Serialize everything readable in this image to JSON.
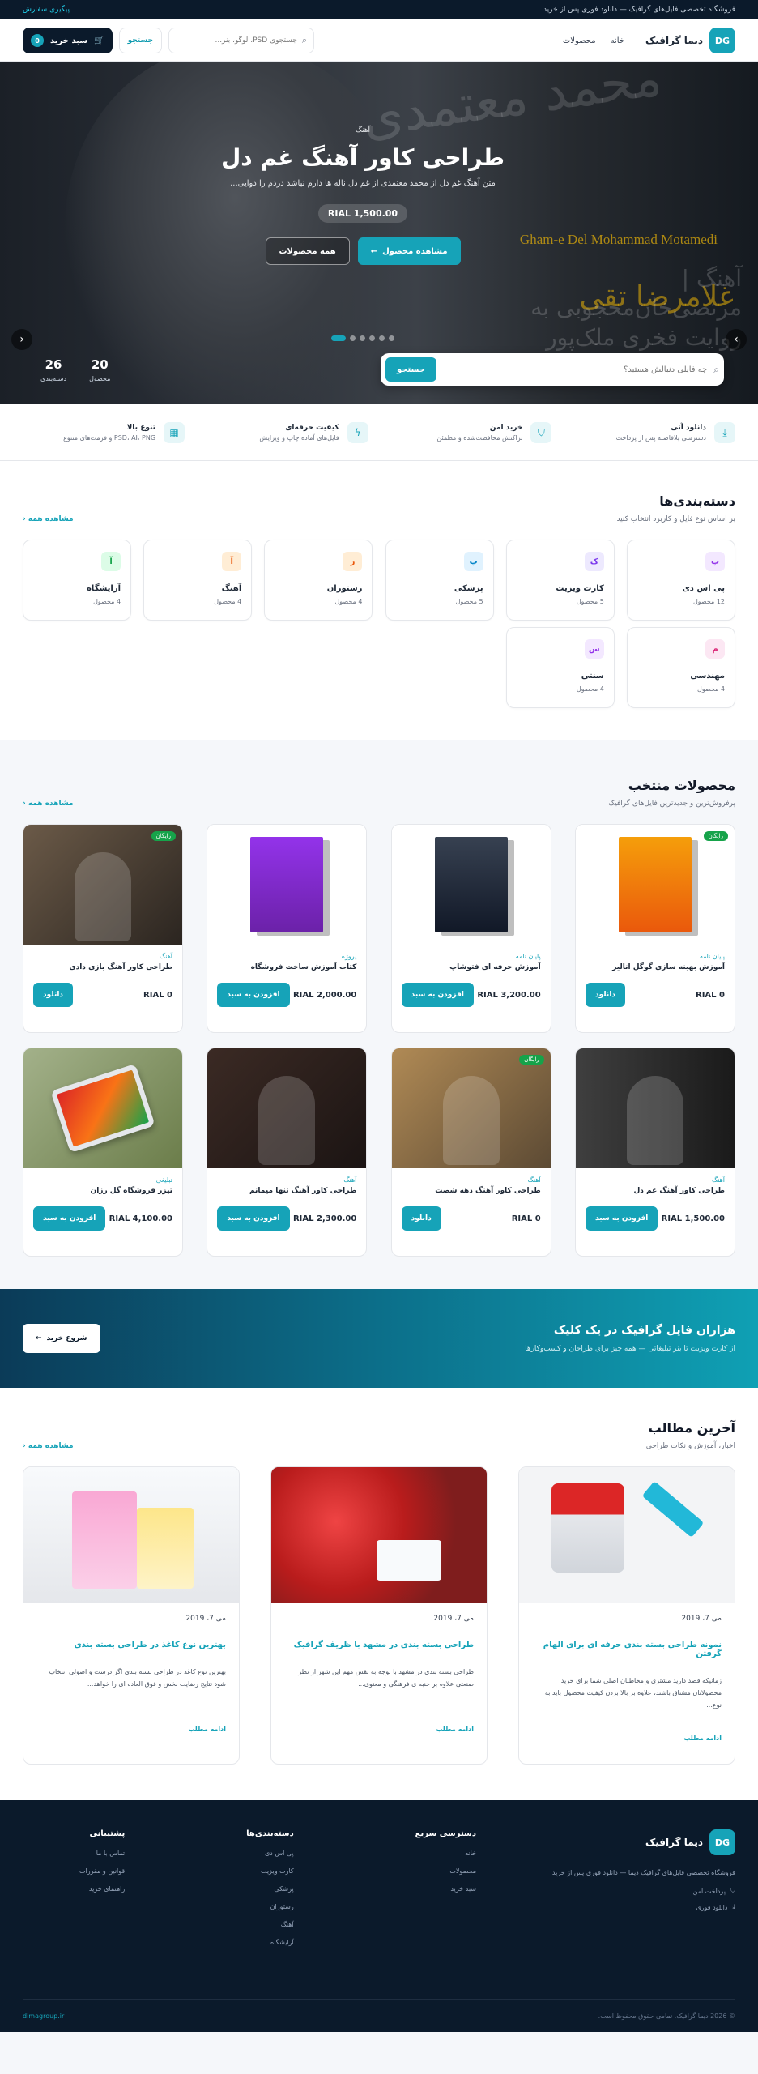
{
  "topbar": {
    "tagline": "فروشگاه تخصصی فایل‌های گرافیک — دانلود فوری پس از خرید",
    "track": "پیگیری سفارش"
  },
  "header": {
    "logo": "DG",
    "brand": "دیما گرافیک",
    "nav": [
      "خانه",
      "محصولات"
    ],
    "search_placeholder": "جستجوی PSD، لوگو، بنر...",
    "search_btn": "جستجو",
    "cart_label": "سبد خرید",
    "cart_count": "0"
  },
  "hero": {
    "category": "آهنگ",
    "title": "طراحی کاور آهنگ غم دل",
    "desc": "متن آهنگ غم دل از محمد معتمدی از غم دل ناله ها دارم نباشد دردم را دوایی...",
    "price": "RIAL 1,500.00",
    "btn_view": "مشاهده محصول",
    "btn_all": "همه محصولات",
    "search_placeholder": "چه فایلی دنبالش هستید؟",
    "search_btn": "جستجو",
    "stats": [
      {
        "num": "20",
        "label": "محصول"
      },
      {
        "num": "26",
        "label": "دسته‌بندی"
      }
    ],
    "bg_text_fa": "محمد معتمدی",
    "bg_text_en": "Gham-e Del Mohammad Motamedi",
    "bg_text_yellow": "غلامرضا تقی",
    "bg_credits": "آهنگ | مرتضی‌خان‌محجوبی به روایت فخری ملک‌پور"
  },
  "features": [
    {
      "icon": "⤓",
      "title": "دانلود آنی",
      "sub": "دسترسی بلافاصله پس از پرداخت"
    },
    {
      "icon": "⛉",
      "title": "خرید امن",
      "sub": "تراکنش محافظت‌شده و مطمئن"
    },
    {
      "icon": "ϟ",
      "title": "کیفیت حرفه‌ای",
      "sub": "فایل‌های آماده چاپ و ویرایش"
    },
    {
      "icon": "▦",
      "title": "تنوع بالا",
      "sub": "PSD، AI، PNG و فرمت‌های متنوع"
    }
  ],
  "categories": {
    "title": "دسته‌بندی‌ها",
    "sub": "بر اساس نوع فایل و کاربرد انتخاب کنید",
    "see_all": "مشاهده همه",
    "items": [
      {
        "letter": "پ",
        "name": "پی اس دی",
        "count": "12 محصول",
        "bg": "#f3e8ff",
        "fg": "#9333ea"
      },
      {
        "letter": "ک",
        "name": "کارت ویزیت",
        "count": "5 محصول",
        "bg": "#ede9fe",
        "fg": "#7c3aed"
      },
      {
        "letter": "پ",
        "name": "پزشکی",
        "count": "5 محصول",
        "bg": "#e0f2fe",
        "fg": "#0284c7"
      },
      {
        "letter": "ر",
        "name": "رستوران",
        "count": "4 محصول",
        "bg": "#ffedd5",
        "fg": "#ea580c"
      },
      {
        "letter": "آ",
        "name": "آهنگ",
        "count": "4 محصول",
        "bg": "#ffedd5",
        "fg": "#ea580c"
      },
      {
        "letter": "آ",
        "name": "آرایشگاه",
        "count": "4 محصول",
        "bg": "#dcfce7",
        "fg": "#16a34a"
      },
      {
        "letter": "م",
        "name": "مهندسی",
        "count": "4 محصول",
        "bg": "#fce7f3",
        "fg": "#db2777"
      },
      {
        "letter": "س",
        "name": "سنتی",
        "count": "4 محصول",
        "bg": "#f3e8ff",
        "fg": "#9333ea"
      }
    ]
  },
  "products": {
    "title": "محصولات منتخب",
    "sub": "پرفروش‌ترین و جدیدترین فایل‌های گرافیک",
    "see_all": "مشاهده همه",
    "items": [
      {
        "cat": "پایان نامه",
        "name": "آموزش بهینه سازی گوگل انالیز",
        "price": "RIAL 0",
        "btn": "دانلود",
        "badge": "رایگان",
        "img": "google"
      },
      {
        "cat": "پایان نامه",
        "name": "آموزش حرفه ای فتوشاپ",
        "price": "RIAL 3,200.00",
        "btn": "افزودن به سبد",
        "badge": "",
        "img": "ps"
      },
      {
        "cat": "پروژه",
        "name": "کتاب آموزش ساخت فروشگاه",
        "price": "RIAL 2,000.00",
        "btn": "افزودن به سبد",
        "badge": "",
        "img": "shop"
      },
      {
        "cat": "آهنگ",
        "name": "طراحی کاور آهنگ بازی دادی",
        "price": "RIAL 0",
        "btn": "دانلود",
        "badge": "رایگان",
        "img": "man1"
      },
      {
        "cat": "آهنگ",
        "name": "طراحی کاور آهنگ غم دل",
        "price": "RIAL 1,500.00",
        "btn": "افزودن به سبد",
        "badge": "",
        "img": "man2"
      },
      {
        "cat": "آهنگ",
        "name": "طراحی کاور آهنگ دهه شصت",
        "price": "RIAL 0",
        "btn": "دانلود",
        "badge": "رایگان",
        "img": "man3"
      },
      {
        "cat": "آهنگ",
        "name": "طراحی کاور آهنگ تنها میمانم",
        "price": "RIAL 2,300.00",
        "btn": "افزودن به سبد",
        "badge": "",
        "img": "man4"
      },
      {
        "cat": "تبلیغی",
        "name": "تیزر فروشگاه گل رزان",
        "price": "RIAL 4,100.00",
        "btn": "افزودن به سبد",
        "badge": "",
        "img": "tablet"
      }
    ]
  },
  "banner": {
    "title": "هزاران فایل گرافیک در یک کلیک",
    "sub": "از کارت ویزیت تا بنر تبلیغاتی — همه چیز برای طراحان و کسب‌وکارها",
    "btn": "شروع خرید"
  },
  "blog": {
    "title": "آخرین مطالب",
    "sub": "اخبار، آموزش و نکات طراحی",
    "see_all": "مشاهده همه",
    "items": [
      {
        "date": "می 7، 2019",
        "title": "نمونه طراحی بسته بندی حرفه ای برای الهام گرفتن",
        "excerpt": "زمانیکه قصد دارید مشتری و مخاطبان اصلی شما برای خرید محصولاتان مشتاق باشند، علاوه بر بالا بردن کیفیت محصول باید به نوع...",
        "more": "ادامه مطلب",
        "img": "paint"
      },
      {
        "date": "می 7، 2019",
        "title": "طراحی بسته بندی در مشهد با ظریف گرافیک",
        "excerpt": "طراحی بسته بندی در مشهد با توجه به نقش مهم این شهر از نظر صنعتی علاوه بر جنبه ی فرهنگی و معنوی...",
        "more": "ادامه مطلب",
        "img": "berry"
      },
      {
        "date": "می 7، 2019",
        "title": "بهترین نوع کاغذ در طراحی بسته بندی",
        "excerpt": "بهترین نوع کاغذ در طراحی بسته بندی اگر درست و اصولی انتخاب شود نتایج رضایت بخش و فوق العاده ای را خواهد...",
        "more": "ادامه مطلب",
        "img": "bags"
      }
    ]
  },
  "footer": {
    "logo": "DG",
    "brand": "دیما گرافیک",
    "desc": "فروشگاه تخصصی فایل‌های گرافیک دیما — دانلود فوری پس از خرید",
    "feats": [
      "پرداخت امن",
      "دانلود فوری"
    ],
    "cols": [
      {
        "title": "دسترسی سریع",
        "links": [
          "خانه",
          "محصولات",
          "سبد خرید"
        ]
      },
      {
        "title": "دسته‌بندی‌ها",
        "links": [
          "پی اس دی",
          "کارت ویزیت",
          "پزشکی",
          "رستوران",
          "آهنگ",
          "آرایشگاه"
        ]
      },
      {
        "title": "پشتیبانی",
        "links": [
          "تماس با ما",
          "قوانین و مقررات",
          "راهنمای خرید"
        ]
      }
    ],
    "copyright": "© 2026 دیما گرافیک. تمامی حقوق محفوظ است.",
    "site": "dimagroup.ir"
  },
  "colors": {
    "accent": "#16a3b8",
    "dark": "#0b1a2b",
    "free_badge": "#16a34a"
  }
}
